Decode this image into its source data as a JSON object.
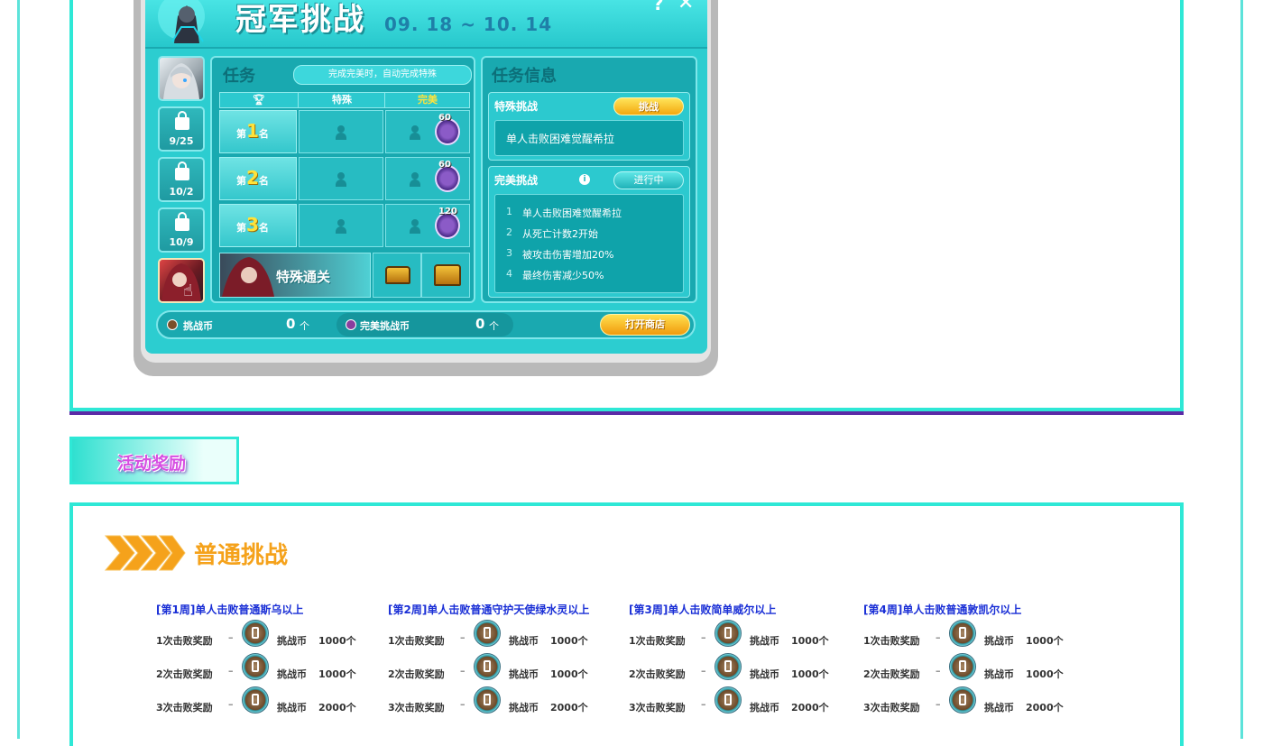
{
  "window": {
    "title": "冠军挑战",
    "dates": "09. 18 ~ 10. 14",
    "help_icon": "question-icon",
    "close_icon": "close-icon"
  },
  "sidebar": {
    "slots": [
      {
        "type": "avatar"
      },
      {
        "type": "locked",
        "date": "9/25"
      },
      {
        "type": "locked",
        "date": "10/2"
      },
      {
        "type": "locked",
        "date": "10/9"
      },
      {
        "type": "avatar-selected"
      }
    ]
  },
  "task": {
    "title": "任务",
    "hint": "完成完美时，自动完成特殊",
    "col_special": "特殊",
    "col_perfect": "完美",
    "ranks": [
      {
        "prefix": "第",
        "num": "1",
        "suffix": "名",
        "medal": "60"
      },
      {
        "prefix": "第",
        "num": "2",
        "suffix": "名",
        "medal": "60"
      },
      {
        "prefix": "第",
        "num": "3",
        "suffix": "名",
        "medal": "120"
      }
    ],
    "special_clear": "特殊通关"
  },
  "info": {
    "title": "任务信息",
    "special": {
      "label": "特殊挑战",
      "button": "挑战",
      "desc": "单人击败困难觉醒希拉"
    },
    "perfect": {
      "label": "完美挑战",
      "status": "进行中",
      "conditions": [
        {
          "n": "1",
          "text": "单人击败困难觉醒希拉"
        },
        {
          "n": "2",
          "text": "从死亡计数2开始"
        },
        {
          "n": "3",
          "text": "被攻击伤害增加20%"
        },
        {
          "n": "4",
          "text": "最终伤害减少50%"
        }
      ]
    }
  },
  "currency": {
    "coin_label": "挑战币",
    "coin_value": "0",
    "perfect_label": "完美挑战币",
    "perfect_value": "0",
    "unit": "个",
    "shop_button": "打开商店"
  },
  "rewards": {
    "tab_label": "活动奖励",
    "section_title": "普通挑战",
    "weeks": [
      {
        "title": "[第1周]单人击败普通斯乌以上",
        "rows": [
          {
            "label": "1次击败奖励",
            "dash": "–",
            "item": "挑战币",
            "qty": "1000个"
          },
          {
            "label": "2次击败奖励",
            "dash": "–",
            "item": "挑战币",
            "qty": "1000个"
          },
          {
            "label": "3次击败奖励",
            "dash": "–",
            "item": "挑战币",
            "qty": "2000个"
          }
        ]
      },
      {
        "title": "[第2周]单人击败普通守护天使绿水灵以上",
        "rows": [
          {
            "label": "1次击败奖励",
            "dash": "–",
            "item": "挑战币",
            "qty": "1000个"
          },
          {
            "label": "2次击败奖励",
            "dash": "–",
            "item": "挑战币",
            "qty": "1000个"
          },
          {
            "label": "3次击败奖励",
            "dash": "–",
            "item": "挑战币",
            "qty": "2000个"
          }
        ]
      },
      {
        "title": "[第3周]单人击败简单威尔以上",
        "rows": [
          {
            "label": "1次击败奖励",
            "dash": "–",
            "item": "挑战币",
            "qty": "1000个"
          },
          {
            "label": "2次击败奖励",
            "dash": "–",
            "item": "挑战币",
            "qty": "1000个"
          },
          {
            "label": "3次击败奖励",
            "dash": "–",
            "item": "挑战币",
            "qty": "2000个"
          }
        ]
      },
      {
        "title": "[第4周]单人击败普通敦凯尔以上",
        "rows": [
          {
            "label": "1次击败奖励",
            "dash": "–",
            "item": "挑战币",
            "qty": "1000个"
          },
          {
            "label": "2次击败奖励",
            "dash": "–",
            "item": "挑战币",
            "qty": "1000个"
          },
          {
            "label": "3次击败奖励",
            "dash": "–",
            "item": "挑战币",
            "qty": "2000个"
          }
        ]
      }
    ]
  },
  "colors": {
    "frame": "#2ee8d6",
    "accent_purple": "#5b2aa6",
    "title_orange": "#f5a21b",
    "week_blue": "#1a2fd6"
  }
}
